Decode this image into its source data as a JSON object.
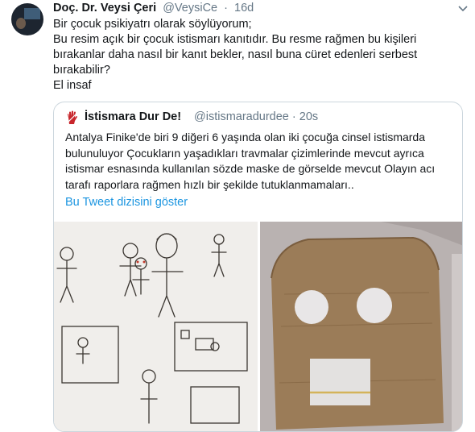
{
  "tweet": {
    "author_name": "Doç. Dr. Veysi Çeri",
    "handle": "@VeysiCe",
    "separator": "·",
    "time": "16d",
    "lines": [
      "Bir çocuk psikiyatrı olarak söylüyorum;",
      "Bu resim açık bir çocuk istismarı kanıtıdır. Bu resme rağmen bu kişileri",
      "bırakanlar daha nasıl bir kanıt bekler, nasıl buna cüret edenleri serbest",
      "bırakabilir?",
      "El insaf"
    ]
  },
  "quoted": {
    "author_name": "İstismara Dur De!",
    "handle": "@istismaradurdee",
    "separator": "·",
    "time": "20s",
    "lines": [
      "Antalya Finike'de biri 9 diğeri 6 yaşında olan iki çocuğa cinsel istismarda",
      "bulunuluyor Çocukların yaşadıkları travmalar çizimlerinde mevcut ayrıca",
      "istismar esnasında kullanılan sözde maske de görselde mevcut Olayın acı",
      "tarafı raporlara rağmen hızlı bir şekilde tutuklanmamaları.."
    ],
    "show_thread_label": "Bu Tweet dizisini göster"
  },
  "icons": {
    "more": "chevron-down-icon",
    "quoted_logo": "hand-stop-icon"
  },
  "colors": {
    "text": "#14171a",
    "muted": "#657786",
    "link": "#1b95e0",
    "border": "#ccd6dd",
    "logo_red": "#c8262c"
  }
}
